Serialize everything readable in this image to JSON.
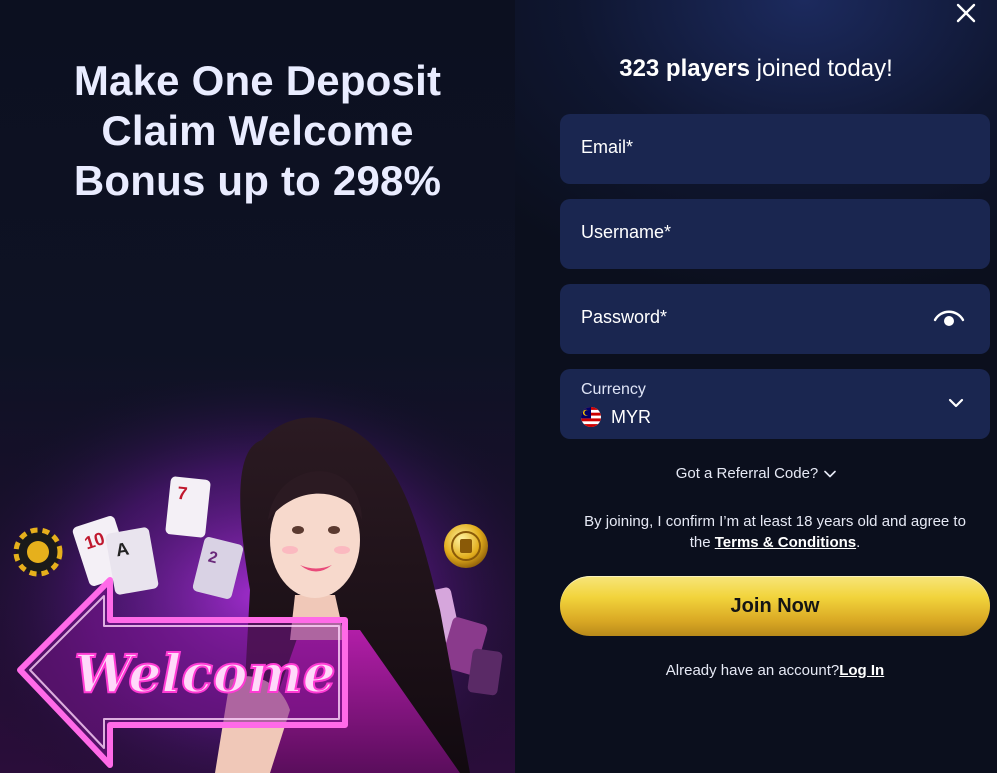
{
  "promo": {
    "title_lines": [
      "Make One Deposit",
      "Claim Welcome",
      "Bonus up to 298%"
    ],
    "sign_text": "Welcome"
  },
  "header": {
    "players_count": "323 players",
    "players_suffix": " joined today!"
  },
  "form": {
    "email_label": "Email*",
    "username_label": "Username*",
    "password_label": "Password*",
    "currency_label": "Currency",
    "currency_value": "MYR",
    "referral_text": "Got a Referral Code?",
    "terms_prefix": "By joining, I confirm I’m at least 18 years old and agree to the ",
    "terms_link": "Terms & Conditions",
    "terms_suffix": ".",
    "join_button": "Join Now",
    "login_prefix": "Already have an account?",
    "login_link": "Log In"
  },
  "colors": {
    "field_bg": "#1a2650",
    "button_gold": "#f2d43c",
    "neon_pink": "#ff3bd4"
  },
  "icons": {
    "close": "close-icon",
    "eye": "eye-icon",
    "flag": "malaysia-flag-icon",
    "chevron": "chevron-down-icon"
  }
}
